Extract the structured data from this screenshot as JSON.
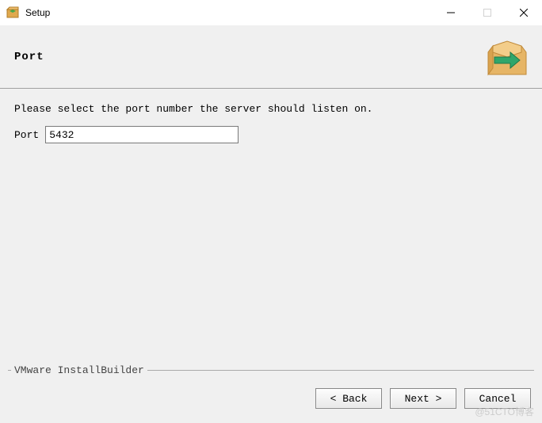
{
  "window": {
    "title": "Setup"
  },
  "header": {
    "heading": "Port"
  },
  "content": {
    "instruction": "Please select the port number the server should listen on.",
    "port_label": "Port",
    "port_value": "5432"
  },
  "footer": {
    "builder_label": "VMware InstallBuilder",
    "back_label": "< Back",
    "next_label": "Next >",
    "cancel_label": "Cancel"
  },
  "watermark": "@51CTO博客"
}
